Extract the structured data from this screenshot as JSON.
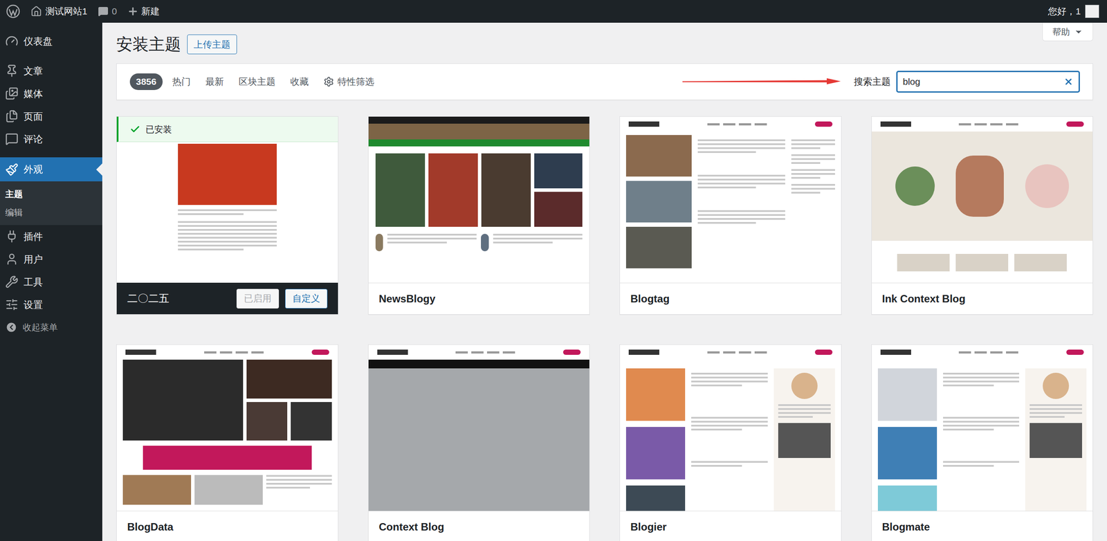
{
  "admin_bar": {
    "site_name": "测试网站1",
    "comment_count": "0",
    "new_label": "新建",
    "greeting": "您好，1"
  },
  "help": {
    "label": "帮助"
  },
  "sidebar": {
    "groups": [
      [
        {
          "label": "仪表盘",
          "selected": false,
          "submenu": []
        }
      ],
      [
        {
          "label": "文章",
          "selected": false,
          "submenu": []
        },
        {
          "label": "媒体",
          "selected": false,
          "submenu": []
        },
        {
          "label": "页面",
          "selected": false,
          "submenu": []
        },
        {
          "label": "评论",
          "selected": false,
          "submenu": []
        }
      ],
      [
        {
          "label": "外观",
          "selected": true,
          "submenu": [
            {
              "label": "主题",
              "selected": true
            },
            {
              "label": "编辑",
              "selected": false
            }
          ]
        },
        {
          "label": "插件",
          "selected": false,
          "submenu": []
        },
        {
          "label": "用户",
          "selected": false,
          "submenu": []
        },
        {
          "label": "工具",
          "selected": false,
          "submenu": []
        },
        {
          "label": "设置",
          "selected": false,
          "submenu": []
        }
      ]
    ],
    "collapse": "收起菜单"
  },
  "page": {
    "title": "安装主题",
    "upload_button": "上传主题"
  },
  "filter_bar": {
    "count": "3856",
    "tabs": [
      {
        "label": "热门",
        "selected": false
      },
      {
        "label": "最新",
        "selected": false
      },
      {
        "label": "区块主题",
        "selected": false
      },
      {
        "label": "收藏",
        "selected": false
      }
    ],
    "feature_filter": "特性筛选",
    "search_label": "搜索主题",
    "search_value": "blog"
  },
  "themes": [
    {
      "name": "二〇二五",
      "installed": true,
      "active": true,
      "installed_label": "已安装",
      "active_label": "已启用",
      "customize_label": "自定义"
    },
    {
      "name": "NewsBlogy",
      "installed": false,
      "active": false
    },
    {
      "name": "Blogtag",
      "installed": false,
      "active": false
    },
    {
      "name": "Ink Context Blog",
      "installed": false,
      "active": false
    },
    {
      "name": "BlogData",
      "installed": false,
      "active": false
    },
    {
      "name": "Context Blog",
      "installed": false,
      "active": false
    },
    {
      "name": "Blogier",
      "installed": false,
      "active": false
    },
    {
      "name": "Blogmate",
      "installed": false,
      "active": false
    }
  ]
}
